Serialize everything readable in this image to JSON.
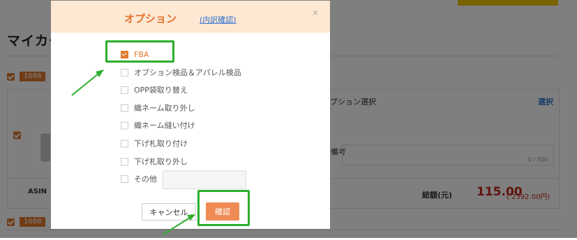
{
  "page": {
    "title": "マイカート",
    "tag": "1688",
    "option_select_label": "オプション選択",
    "select_link": "選択",
    "note_label": "備考",
    "note_counter": "0 / 500",
    "asin_label": "ASIN",
    "total_label": "総額(元)",
    "total_amount": "115.00",
    "total_yen": "( 2392.00円)"
  },
  "modal": {
    "title": "オプション",
    "breakdown_link": "(内訳確認)",
    "close_icon": "×",
    "options": [
      {
        "label": "FBA",
        "checked": true
      },
      {
        "label": "オプション検品＆アパレル検品",
        "checked": false
      },
      {
        "label": "OPP袋取り替え",
        "checked": false
      },
      {
        "label": "織ネーム取り外し",
        "checked": false
      },
      {
        "label": "織ネーム縫い付け",
        "checked": false
      },
      {
        "label": "下げ札取り付け",
        "checked": false
      },
      {
        "label": "下げ札取り外し",
        "checked": false
      },
      {
        "label": "その他",
        "checked": false
      }
    ],
    "other_value": "",
    "cancel_label": "キャンセル",
    "confirm_label": "確認"
  },
  "colors": {
    "accent": "#e07a2f",
    "header_bg": "#fde8d3",
    "confirm_bg": "#ef8c55",
    "price": "#c0251a",
    "annotation": "#2cae2c",
    "link": "#2e6fd1"
  }
}
